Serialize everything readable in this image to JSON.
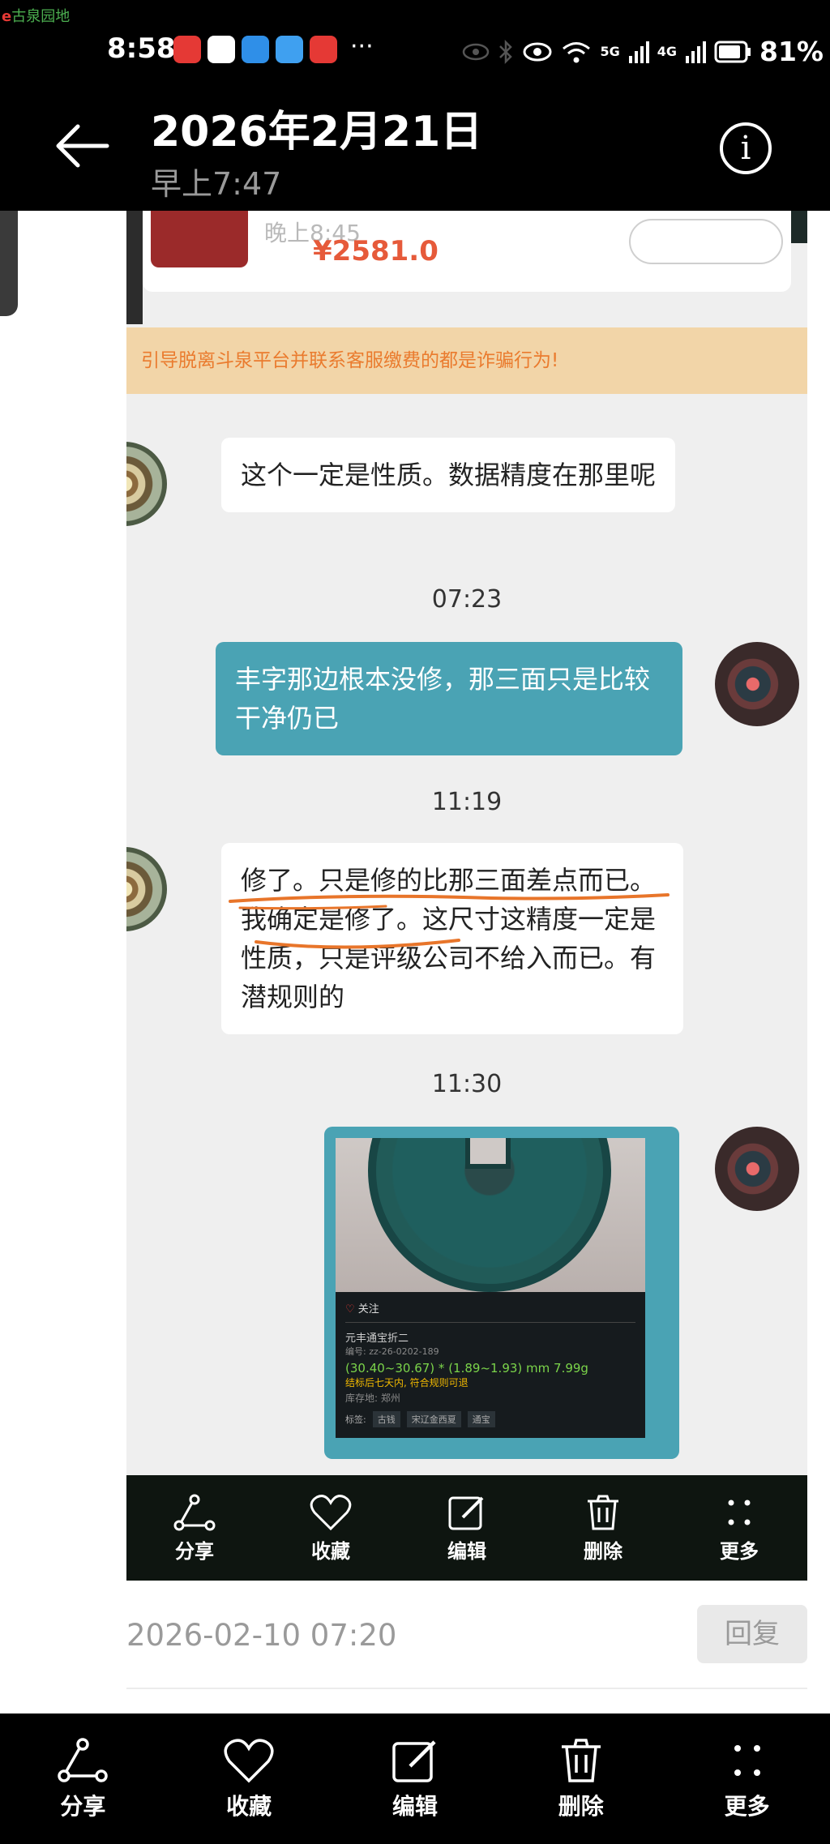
{
  "watermark": "古泉园地",
  "status_bar": {
    "time": "8:58",
    "more": "···",
    "network_labels": [
      "5G",
      "4G"
    ],
    "battery": "81%"
  },
  "header": {
    "title": "2026年2月21日",
    "subtitle": "早上7:47"
  },
  "chat": {
    "prev_card": {
      "time": "晚上8:45",
      "price": "¥2581.0"
    },
    "warning": "引导脱离斗泉平台并联系客服缴费的都是诈骗行为!",
    "messages": [
      {
        "side": "in",
        "text": "这个一定是性质。数据精度在那里呢"
      },
      {
        "time": "07:23"
      },
      {
        "side": "out",
        "text": "丰字那边根本没修，那三面只是比较干净仍已"
      },
      {
        "time": "11:19"
      },
      {
        "side": "in",
        "text": "修了。只是修的比那三面差点而已。我确定是修了。这尺寸这精度一定是性质，只是评级公司不给入而已。有潜规则的"
      },
      {
        "time": "11:30"
      }
    ],
    "msg1_text": "这个一定是性质。数据精度在那里呢",
    "time1": "07:23",
    "msg2_text": "丰字那边根本没修，那三面只是比较干净仍已",
    "time2": "11:19",
    "msg3_text": "修了。只是修的比那三面差点而已。我确定是修了。这尺寸这精度一定是性质，只是评级公司不给入而已。有潜规则的",
    "time3": "11:30",
    "image_card": {
      "follow": "关注",
      "name": "元丰通宝折二",
      "code": "编号: zz-26-0202-189",
      "size": "(30.40~30.67) * (1.89~1.93) mm 7.99g",
      "note": "结标后七天内, 符合规则可退",
      "location": "库存地: 郑州",
      "tags_label": "标签:",
      "tags": [
        "古钱",
        "宋辽金西夏",
        "通宝"
      ]
    }
  },
  "inner_toolbar": [
    {
      "icon": "share-icon",
      "label": "分享"
    },
    {
      "icon": "heart-icon",
      "label": "收藏"
    },
    {
      "icon": "edit-icon",
      "label": "编辑"
    },
    {
      "icon": "trash-icon",
      "label": "删除"
    },
    {
      "icon": "more-icon",
      "label": "更多"
    }
  ],
  "meta": {
    "date": "2026-02-10 07:20",
    "reply": "回复"
  },
  "bottom_bar": [
    {
      "icon": "share-icon",
      "label": "分享"
    },
    {
      "icon": "heart-icon",
      "label": "收藏"
    },
    {
      "icon": "edit-icon",
      "label": "编辑"
    },
    {
      "icon": "trash-icon",
      "label": "删除"
    },
    {
      "icon": "more-icon",
      "label": "更多"
    }
  ],
  "colors": {
    "bubble_out": "#4aa3b4",
    "warning_bg": "#f2d5a8",
    "warning_text": "#ea7b2e",
    "annotation": "#e8752a"
  }
}
